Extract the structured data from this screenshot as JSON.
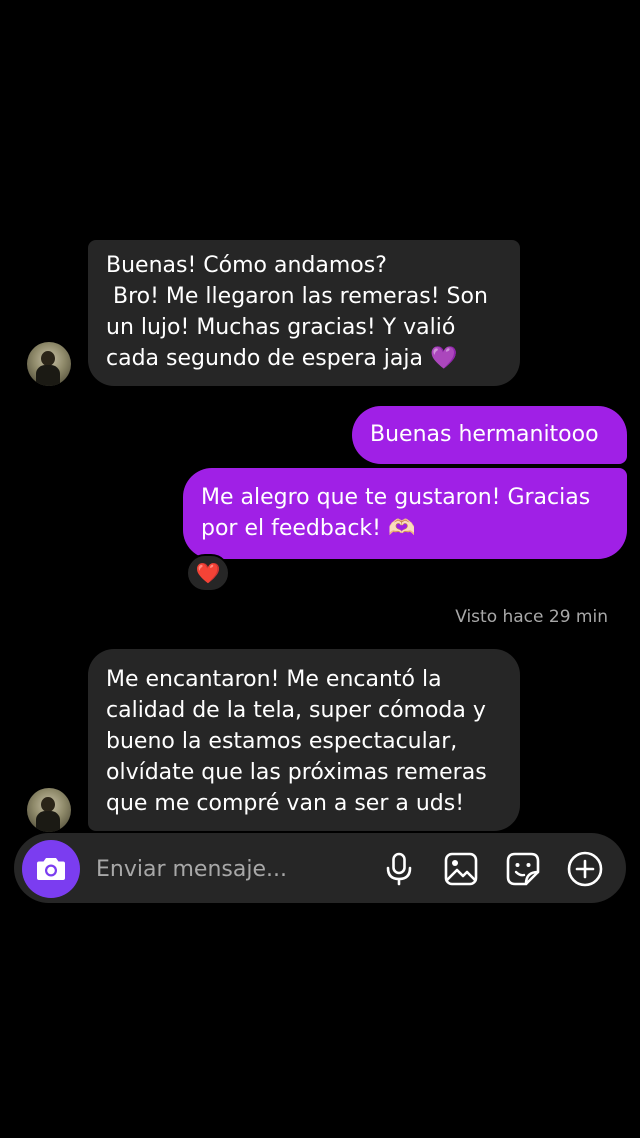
{
  "conversation": {
    "messages": [
      {
        "direction": "incoming",
        "text": "Buenas! Cómo andamos?\n Bro! Me llegaron las remeras! Son un lujo! Muchas gracias! Y valió cada segundo de espera jaja 💜"
      },
      {
        "direction": "outgoing",
        "text": "Buenas hermanitooo"
      },
      {
        "direction": "outgoing",
        "text": "Me alegro que te gustaron! Gracias por el feedback! 🫶🏻",
        "reaction": "❤️"
      },
      {
        "direction": "incoming",
        "text": "Me encantaron! Me encantó la calidad de la tela, super cómoda y bueno la estamos espectacular, olvídate que las próximas remeras que me compré van a ser a uds!"
      }
    ],
    "seen_status": "Visto hace 29 min"
  },
  "composer": {
    "placeholder": "Enviar mensaje...",
    "icons": [
      "camera-icon",
      "microphone-icon",
      "gallery-icon",
      "sticker-icon",
      "plus-icon"
    ]
  },
  "colors": {
    "background": "#000000",
    "incoming_bubble": "#262626",
    "outgoing_bubble": "#a020e6",
    "camera_button": "#7b3df0",
    "seen_text": "#a8a8a8"
  }
}
